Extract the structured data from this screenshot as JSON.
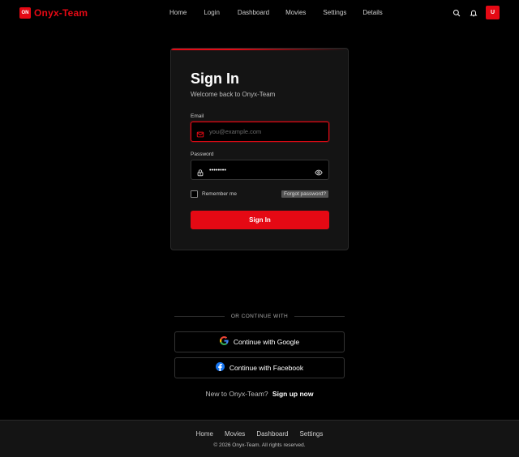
{
  "brand": {
    "badge": "ON",
    "name": "Onyx-Team",
    "color": "#e50914"
  },
  "nav": {
    "links": [
      "Home",
      "Login",
      "Dashboard",
      "Movies",
      "Settings",
      "Details"
    ],
    "search_icon": "search-icon",
    "notifications_icon": "bell-icon",
    "avatar_initial": "U"
  },
  "signin": {
    "title": "Sign In",
    "subtitle": "Welcome back to Onyx-Team",
    "email_label": "Email",
    "email_placeholder": "you@example.com",
    "email_value": "",
    "password_label": "Password",
    "password_value": "••••••••",
    "remember_label": "Remember me",
    "remember_checked": false,
    "forgot_label": "Forgot password?",
    "submit_label": "Sign In"
  },
  "social": {
    "divider": "OR CONTINUE WITH",
    "google_label": "Continue with Google",
    "facebook_label": "Continue with Facebook"
  },
  "signup": {
    "prompt": "New to Onyx-Team?",
    "link": "Sign up now"
  },
  "footer": {
    "links": [
      "Home",
      "Movies",
      "Dashboard",
      "Settings"
    ],
    "copyright": "© 2026 Onyx-Team. All rights reserved."
  }
}
